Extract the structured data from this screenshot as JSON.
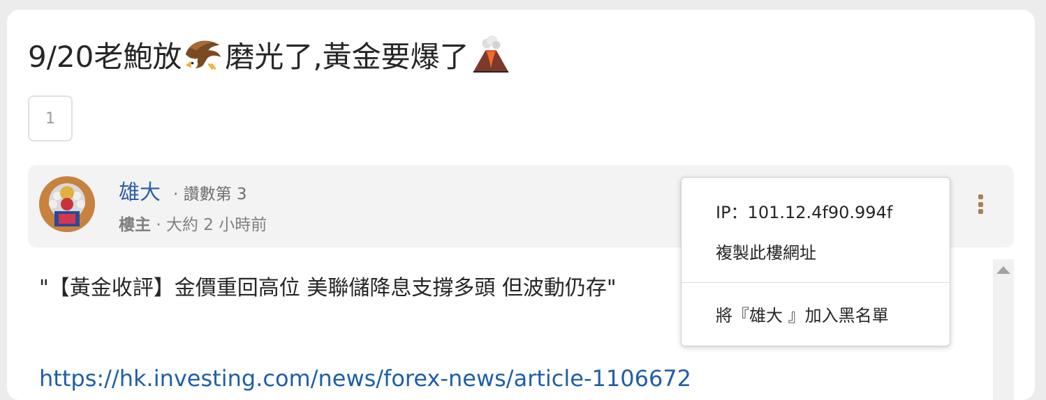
{
  "post": {
    "title_part1": "9/20老鮑放",
    "title_part2": "磨光了,黃金要爆了",
    "page_number": "1"
  },
  "author": {
    "name": "雄大",
    "likes_text": "· 讚數第 3",
    "op_label": "樓主",
    "separator": "·",
    "time_text": "大約 2 小時前"
  },
  "content": {
    "quote_text": "\"【黃金收評】金價重回高位 美聯儲降息支撐多頭 但波動仍存\"",
    "link_text": "https://hk.investing.com/news/forex-news/article-1106672"
  },
  "context_menu": {
    "ip_text": "IP：101.12.4f90.994f",
    "copy_url_label": "複製此樓網址",
    "blacklist_label": "將『雄大 』加入黑名單"
  },
  "icons": {
    "title_emoji_1": "eagle-icon",
    "title_emoji_2": "volcano-icon",
    "menu_trigger": "kebab-menu-icon"
  },
  "colors": {
    "author_link": "#2d5fa8",
    "url_link": "#1f5ea8",
    "kebab_accent": "#a88155"
  }
}
